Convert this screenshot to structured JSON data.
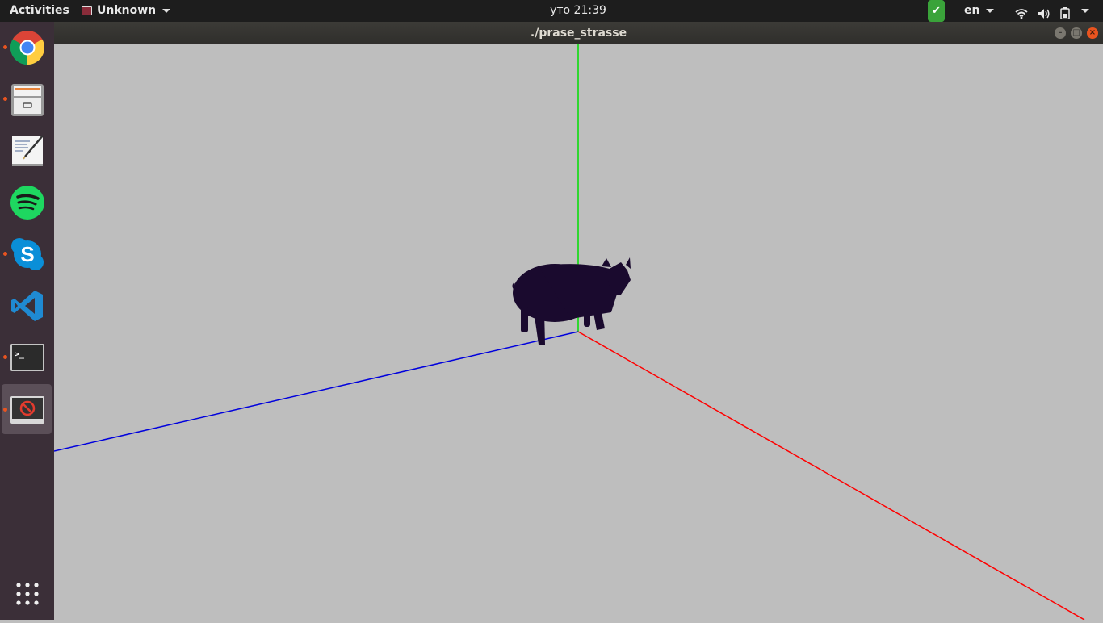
{
  "topbar": {
    "activities": "Activities",
    "app_menu": "Unknown",
    "clock": "уто 21:39",
    "lang": "en",
    "check_icon": "✔"
  },
  "dock": {
    "items": [
      {
        "name": "chrome",
        "running": true
      },
      {
        "name": "files",
        "running": true
      },
      {
        "name": "text-editor",
        "running": false
      },
      {
        "name": "spotify",
        "running": false
      },
      {
        "name": "skype",
        "running": true
      },
      {
        "name": "vscode",
        "running": false
      },
      {
        "name": "terminal",
        "running": true
      },
      {
        "name": "unknown-app",
        "running": true,
        "active": true
      }
    ],
    "show_apps": "show-applications-icon"
  },
  "window": {
    "title": "./prase_strasse",
    "buttons": {
      "minimize": "–",
      "maximize": "□",
      "close": "×"
    }
  },
  "scene": {
    "background": "#bebebe",
    "axes": {
      "x_color": "#ff0000",
      "y_color": "#00dd00",
      "z_color": "#0000dd"
    },
    "object": "pig-silhouette",
    "object_color": "#1a0a2e"
  }
}
